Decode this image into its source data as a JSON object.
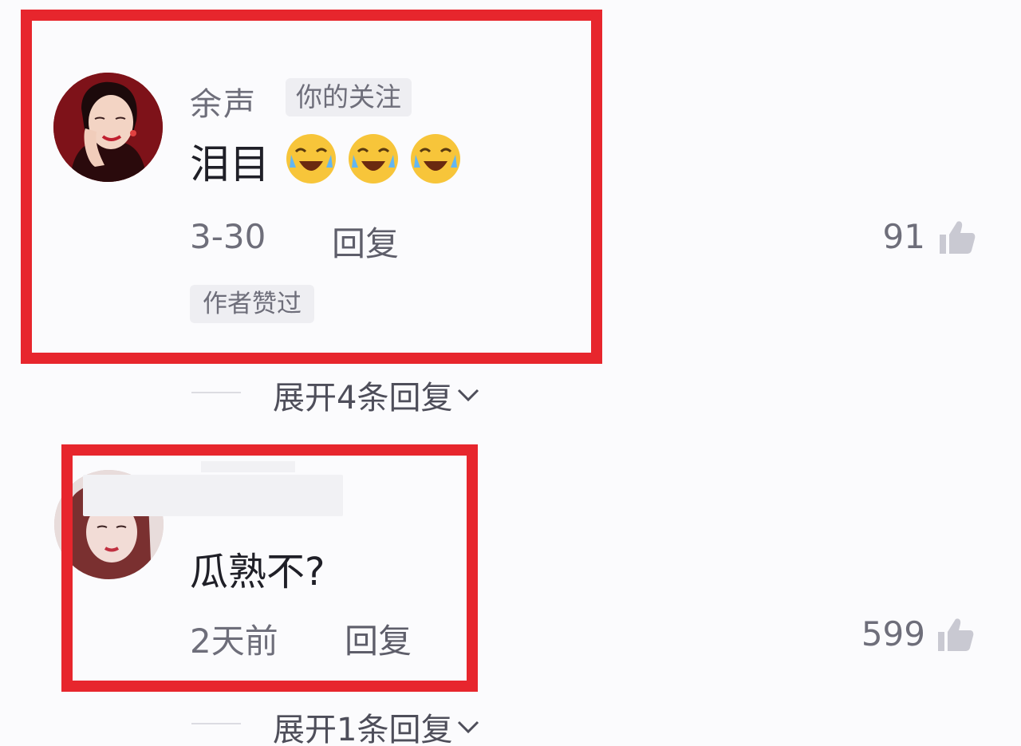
{
  "comments": [
    {
      "username": "余声",
      "follow_tag": "你的关注",
      "text": "泪目",
      "emojis": [
        "crying-laugh-emoji",
        "crying-laugh-emoji",
        "crying-laugh-emoji"
      ],
      "time": "3-30",
      "reply_label": "回复",
      "author_liked": "作者赞过",
      "likes": "91",
      "expand_label": "展开4条回复"
    },
    {
      "text": "瓜熟不?",
      "time": "2天前",
      "reply_label": "回复",
      "likes": "599",
      "expand_label": "展开1条回复"
    }
  ],
  "colors": {
    "highlight": "#e7262d",
    "background": "#fbfbfd",
    "meta_text": "#6e6e7a"
  },
  "icons": {
    "like": "thumbs-up-icon",
    "expand": "chevron-down-icon"
  }
}
